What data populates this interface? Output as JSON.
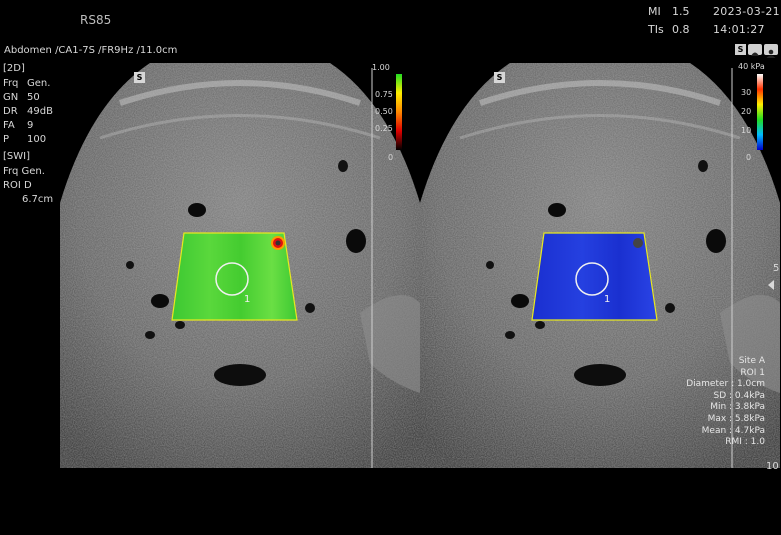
{
  "header": {
    "device": "RS85",
    "mi_label": "MI",
    "mi_value": "1.5",
    "tis_label": "TIs",
    "tis_value": "0.8",
    "date": "2023-03-21",
    "time": "14:01:27",
    "preset": "Abdomen /CA1-7S /FR9Hz /11.0cm"
  },
  "params_2d": {
    "title": "[2D]",
    "rows": [
      {
        "k": "Frq",
        "v": "Gen."
      },
      {
        "k": "GN",
        "v": "50"
      },
      {
        "k": "DR",
        "v": "49dB"
      },
      {
        "k": "FA",
        "v": "9"
      },
      {
        "k": "P",
        "v": "100"
      }
    ]
  },
  "params_swi": {
    "title": "[SWI]",
    "frq": "Frq Gen.",
    "roi": "ROI D",
    "roi_depth": "6.7cm"
  },
  "icons": {
    "left_s": "S",
    "right_s": "S",
    "top_s": "S"
  },
  "left_scale": {
    "labels": [
      "1.00",
      "0.75",
      "0.50",
      "0.25",
      "0"
    ],
    "colors": [
      "#22dd22",
      "#ffee00",
      "#ff8800",
      "#dd0000",
      "#000000"
    ]
  },
  "right_scale": {
    "unit": "40 kPa",
    "labels": [
      "30",
      "20",
      "10",
      "0"
    ],
    "colors": [
      "#ffffff",
      "#ff3300",
      "#ffee00",
      "#22dd22",
      "#00bbff",
      "#0000cc"
    ]
  },
  "roi_left": {
    "label": "1",
    "fill": "#3cc832"
  },
  "roi_right": {
    "label": "1",
    "fill": "#1a2fd0"
  },
  "depth_marks": {
    "mid": "5",
    "bottom": "10"
  },
  "stats": {
    "site": "Site A",
    "roi": "ROI 1",
    "diameter": "Diameter : 1.0cm",
    "sd": "SD : 0.4kPa",
    "min": "Min : 3.8kPa",
    "max": "Max : 5.8kPa",
    "mean": "Mean : 4.7kPa",
    "rmi": "RMI : 1.0"
  }
}
